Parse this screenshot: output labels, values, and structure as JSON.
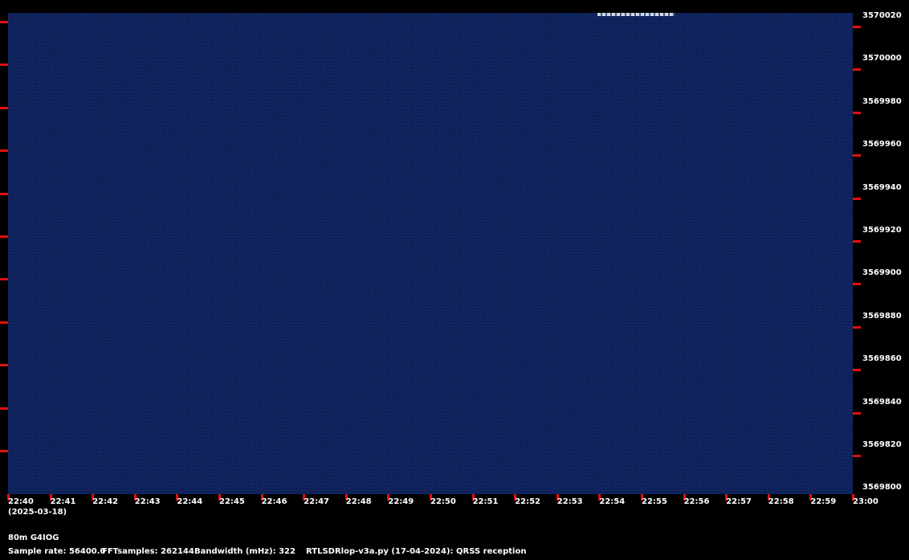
{
  "frequency_labels": [
    "3570020",
    "3570000",
    "3569980",
    "3569960",
    "3569940",
    "3569920",
    "3569900",
    "3569880",
    "3569860",
    "3569840",
    "3569820",
    "3569800"
  ],
  "time_labels": [
    "22:40",
    "22:41",
    "22:42",
    "22:43",
    "22:44",
    "22:45",
    "22:46",
    "22:47",
    "22:48",
    "22:49",
    "22:50",
    "22:51",
    "22:52",
    "22:53",
    "22:54",
    "22:55",
    "22:56",
    "22:57",
    "22:58",
    "22:59",
    "23:00"
  ],
  "date": "(2025-03-18)",
  "station": "80m G4IOG",
  "sample_rate": "Sample rate: 56400.0",
  "fft_samples": "FFTsamples: 262144",
  "bandwidth": "Bandwidth (mHz): 322",
  "software": "RTLSDRlop-v3a.py (17-04-2024): QRSS reception",
  "colors": {
    "background": "#000000",
    "waterfall": "#0c1e55",
    "ticks": "#e01010",
    "text": "#ffffff"
  }
}
